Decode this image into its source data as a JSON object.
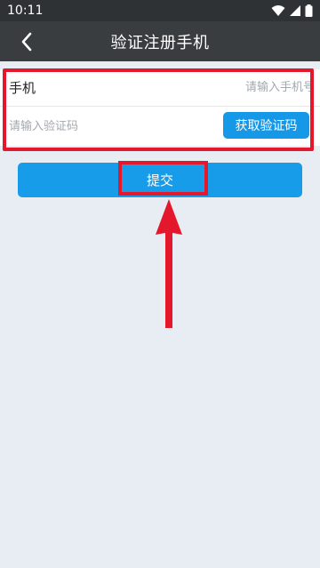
{
  "status_bar": {
    "time": "10:11",
    "icons": [
      "wifi-icon",
      "signal-icon",
      "battery-icon"
    ]
  },
  "app_bar": {
    "title": "验证注册手机",
    "back_icon": "chevron-left-icon"
  },
  "form": {
    "phone_label": "手机",
    "phone_placeholder": "请输入手机号",
    "code_placeholder": "请输入验证码",
    "get_code_label": "获取验证码"
  },
  "submit_label": "提交",
  "colors": {
    "accent": "#169CE9",
    "highlight": "#E3182D",
    "app_bar": "#3A3D40",
    "background": "#E8EDF4"
  }
}
